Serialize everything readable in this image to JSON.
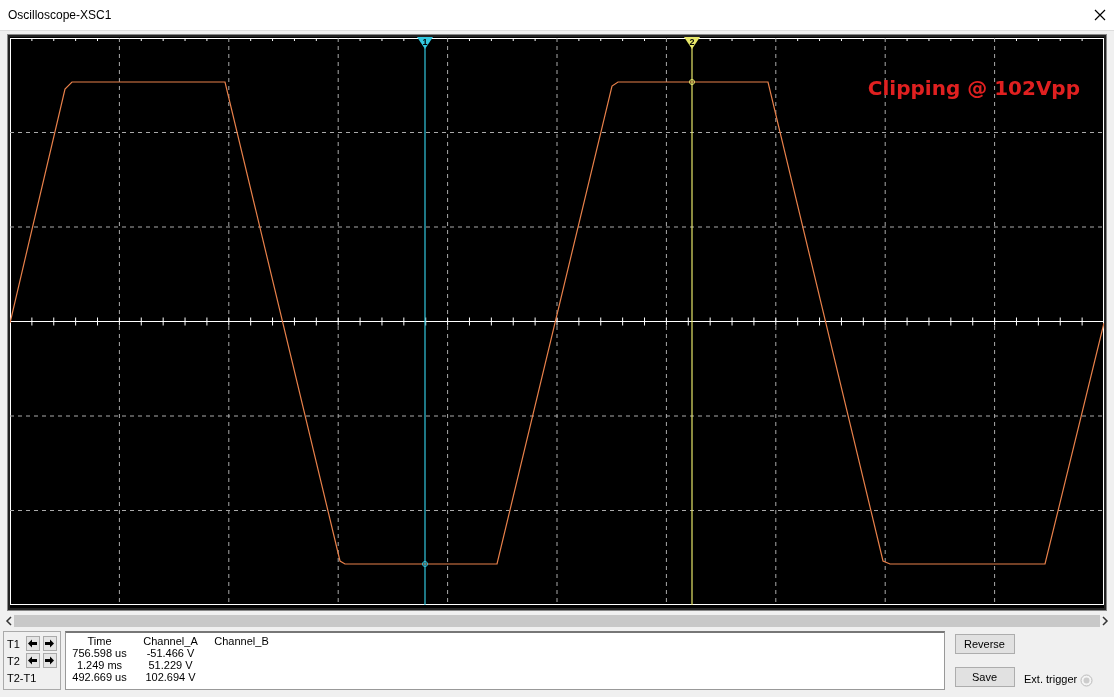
{
  "window": {
    "title": "Oscilloscope-XSC1"
  },
  "scope": {
    "annotation": "Clipping @ 102Vpp",
    "cursors": [
      {
        "label": "1",
        "color": "#33c8e0"
      },
      {
        "label": "2",
        "color": "#e8e86a"
      }
    ]
  },
  "cursor_controls": [
    {
      "label": "T1",
      "arrows": true
    },
    {
      "label": "T2",
      "arrows": true
    },
    {
      "label": "T2-T1",
      "arrows": false
    }
  ],
  "readout": {
    "columns": [
      "Time",
      "Channel_A",
      "Channel_B"
    ],
    "rows": [
      [
        "756.598 us",
        "-51.466 V"
      ],
      [
        "1.249 ms",
        "51.229 V"
      ],
      [
        "492.669 us",
        "102.694 V"
      ]
    ]
  },
  "buttons": [
    "Reverse",
    "Save"
  ],
  "ext_trigger": {
    "label": "Ext. trigger",
    "checked": false
  }
}
